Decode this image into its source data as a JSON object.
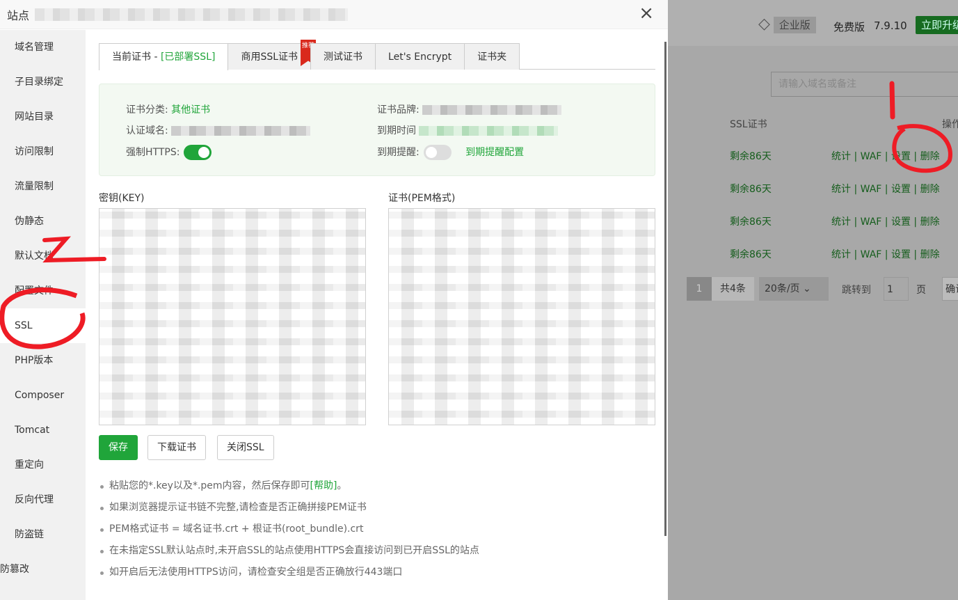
{
  "background": {
    "edition_badge": "企业版",
    "free_label": "免费版",
    "version": "7.9.10",
    "upgrade_button": "立即升级",
    "search_placeholder": "请输入域名或备注",
    "columns": {
      "ssl": "SSL证书",
      "actions": "操作"
    },
    "rows": [
      {
        "ssl": "剩余86天",
        "actions": [
          "统计",
          "WAF",
          "设置",
          "删除"
        ]
      },
      {
        "ssl": "剩余86天",
        "actions": [
          "统计",
          "WAF",
          "设置",
          "删除"
        ]
      },
      {
        "ssl": "剩余86天",
        "actions": [
          "统计",
          "WAF",
          "设置",
          "删除"
        ]
      },
      {
        "ssl": "剩余86天",
        "actions": [
          "统计",
          "WAF",
          "设置",
          "删除"
        ]
      }
    ],
    "pagination": {
      "current": "1",
      "total": "共4条",
      "page_size": "20条/页",
      "jump_label": "跳转到",
      "jump_value": "1",
      "page_unit": "页",
      "confirm": "确认"
    }
  },
  "modal": {
    "title": "站点",
    "sidebar": [
      "域名管理",
      "子目录绑定",
      "网站目录",
      "访问限制",
      "流量限制",
      "伪静态",
      "默认文档",
      "配置文件",
      "SSL",
      "PHP版本",
      "Composer",
      "Tomcat",
      "重定向",
      "反向代理",
      "防盗链",
      "防篡改"
    ],
    "active_item": "SSL",
    "tabs": [
      {
        "label": "当前证书 - ",
        "status": "[已部署SSL]"
      },
      {
        "label": "商用SSL证书",
        "ribbon": "推荐"
      },
      {
        "label": "测试证书"
      },
      {
        "label": "Let's Encrypt"
      },
      {
        "label": "证书夹"
      }
    ],
    "info": {
      "category_label": "证书分类:",
      "category_value": "其他证书",
      "brand_label": "证书品牌:",
      "domain_label": "认证域名:",
      "expire_label": "到期时间",
      "force_https_label": "强制HTTPS:",
      "force_https": true,
      "remind_label": "到期提醒:",
      "remind": false,
      "remind_config": "到期提醒配置"
    },
    "key_label": "密钥(KEY)",
    "cert_label": "证书(PEM格式)",
    "buttons": {
      "save": "保存",
      "download": "下载证书",
      "close_ssl": "关闭SSL"
    },
    "tips": [
      {
        "text": "粘贴您的*.key以及*.pem内容，然后保存即可",
        "link": "[帮助]",
        "suffix": "。"
      },
      {
        "text": "如果浏览器提示证书链不完整,请检查是否正确拼接PEM证书"
      },
      {
        "text": "PEM格式证书 = 域名证书.crt + 根证书(root_bundle).crt"
      },
      {
        "text": "在未指定SSL默认站点时,未开启SSL的站点使用HTTPS会直接访问到已开启SSL的站点"
      },
      {
        "text": "如开启后无法使用HTTPS访问，请检查安全组是否正确放行443端口"
      }
    ]
  },
  "annotations": {
    "mark1": "1",
    "mark2": "2",
    "color": "#ee1c25"
  }
}
